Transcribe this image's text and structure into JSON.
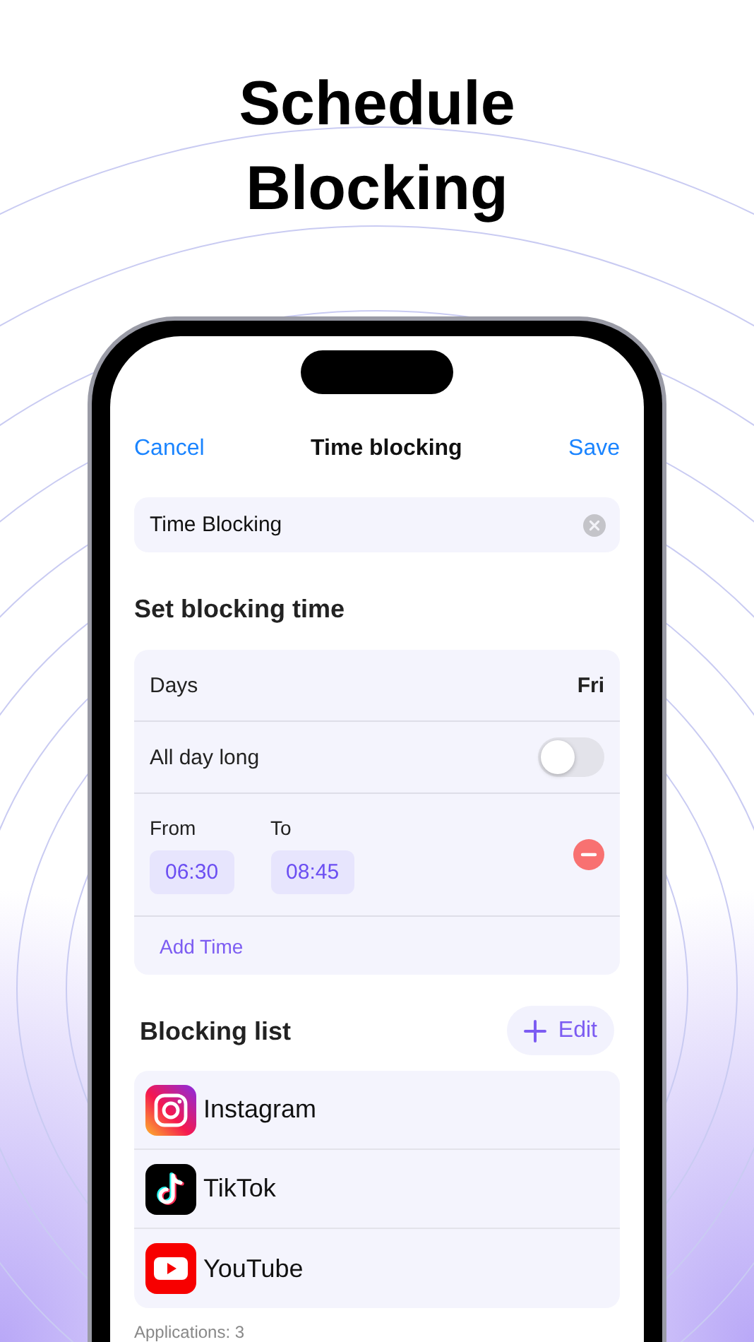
{
  "headline": "Schedule Blocking",
  "nav": {
    "cancel": "Cancel",
    "title": "Time blocking",
    "save": "Save"
  },
  "name_field": {
    "value": "Time Blocking"
  },
  "schedule": {
    "heading": "Set blocking time",
    "days": {
      "label": "Days",
      "value": "Fri"
    },
    "all_day": {
      "label": "All day long",
      "on": false
    },
    "times": [
      {
        "from_label": "From",
        "from": "06:30",
        "to_label": "To",
        "to": "08:45"
      }
    ],
    "add_time": "Add Time"
  },
  "blocking_list": {
    "heading": "Blocking list",
    "edit": "Edit",
    "apps": [
      {
        "name": "Instagram"
      },
      {
        "name": "TikTok"
      },
      {
        "name": "YouTube"
      }
    ],
    "footer": "Applications: 3"
  }
}
